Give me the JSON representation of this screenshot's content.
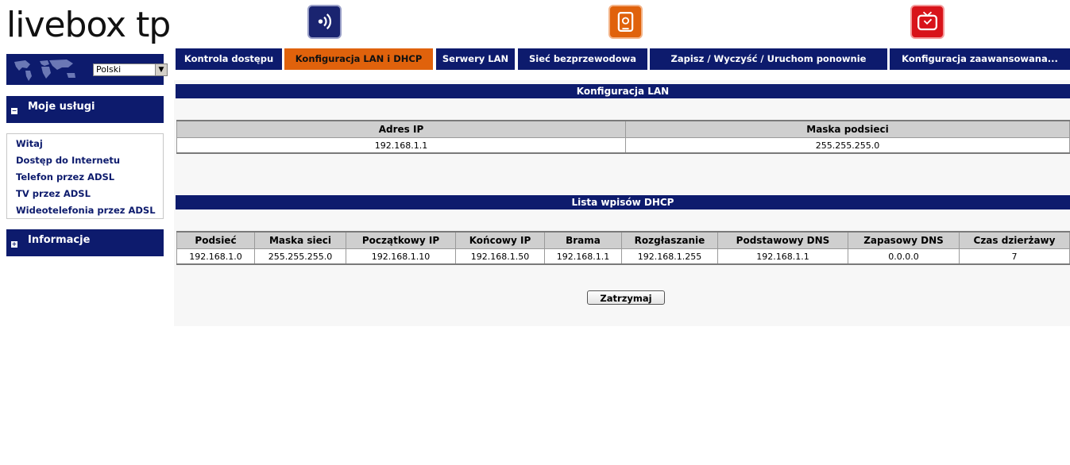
{
  "logo": "livebox tp",
  "language": {
    "selected": "Polski"
  },
  "sidebar": {
    "services_title": "Moje usługi",
    "services_toggle": "−",
    "services": [
      "Witaj",
      "Dostęp do Internetu",
      "Telefon przez ADSL",
      "TV przez ADSL",
      "Wideotelefonia przez ADSL"
    ],
    "info_title": "Informacje",
    "info_toggle": "+"
  },
  "tabs": [
    {
      "label": "Kontrola dostępu"
    },
    {
      "label": "Konfiguracja LAN i DHCP",
      "active": true
    },
    {
      "label": "Serwery LAN"
    },
    {
      "label": "Sieć bezprzewodowa"
    },
    {
      "label": "Zapisz / Wyczyść / Uruchom ponownie"
    },
    {
      "label": "Konfiguracja zaawansowana..."
    }
  ],
  "lan": {
    "title": "Konfiguracja LAN",
    "headers": [
      "Adres IP",
      "Maska podsieci"
    ],
    "row": [
      "192.168.1.1",
      "255.255.255.0"
    ]
  },
  "dhcp": {
    "title": "Lista wpisów DHCP",
    "headers": [
      "Podsieć",
      "Maska sieci",
      "Początkowy IP",
      "Końcowy IP",
      "Brama",
      "Rozgłaszanie",
      "Podstawowy DNS",
      "Zapasowy DNS",
      "Czas dzierżawy"
    ],
    "row": [
      "192.168.1.0",
      "255.255.255.0",
      "192.168.1.10",
      "192.168.1.50",
      "192.168.1.1",
      "192.168.1.255",
      "192.168.1.1",
      "0.0.0.0",
      "7"
    ]
  },
  "buttons": {
    "stop": "Zatrzymaj"
  },
  "colors": {
    "navy": "#0d1b6d",
    "orange": "#e0620c",
    "red": "#d8131a"
  },
  "icons": [
    "voip-icon",
    "email-icon",
    "tv-icon",
    "world-map-icon",
    "dropdown-arrow-icon"
  ]
}
